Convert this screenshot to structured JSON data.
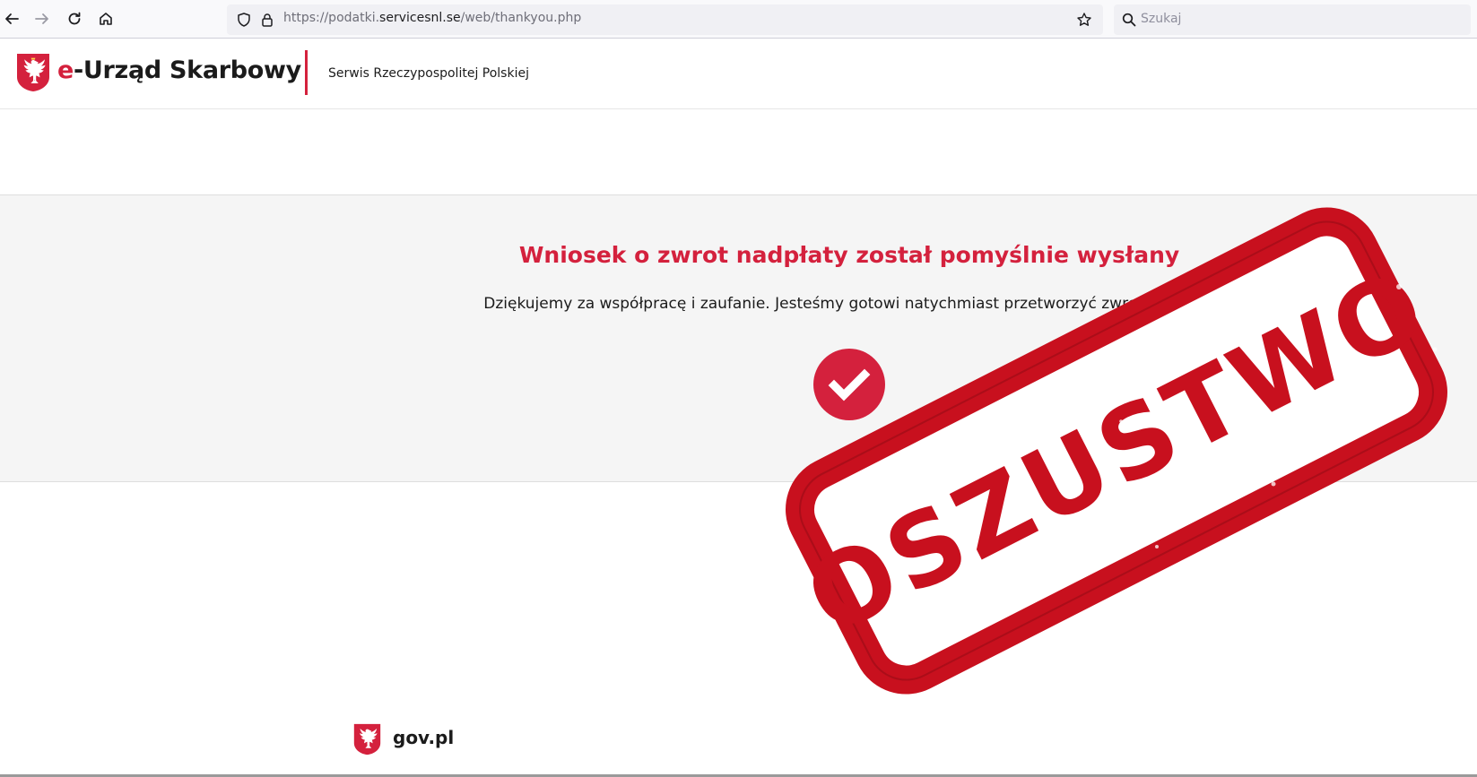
{
  "browser": {
    "url_prefix": "https://podatki.",
    "url_domain": "servicesnl.se",
    "url_path": "/web/thankyou.php",
    "search_placeholder": "Szukaj"
  },
  "header": {
    "brand_e": "e",
    "brand_rest": "-Urząd Skarbowy",
    "subtitle": "Serwis Rzeczypospolitej Polskiej"
  },
  "main": {
    "headline": "Wniosek o zwrot nadpłaty został pomyślnie wysłany",
    "message": "Dziękujemy za współpracę i zaufanie. Jesteśmy gotowi natychmiast przetworzyć zwrot podatku."
  },
  "footer": {
    "label": "gov.pl"
  },
  "stamp": {
    "text": "OSZUSTWO"
  },
  "colors": {
    "brand_red": "#d4213d",
    "stamp_red": "#c8101e",
    "band_gray": "#f5f5f5"
  },
  "icons": [
    "back-arrow-icon",
    "forward-arrow-icon",
    "reload-icon",
    "home-icon",
    "shield-icon",
    "lock-icon",
    "bookmark-star-icon",
    "search-icon",
    "eagle-emblem-icon",
    "checkmark-icon"
  ]
}
